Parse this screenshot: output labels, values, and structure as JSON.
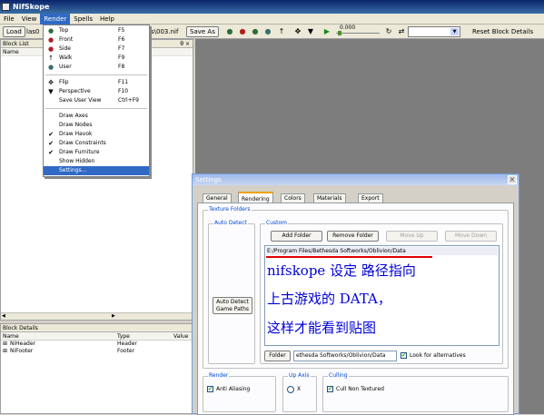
{
  "window": {
    "title": "NifSkope"
  },
  "menubar": {
    "items": [
      "File",
      "View",
      "Render",
      "Spells",
      "Help"
    ]
  },
  "toolbar": {
    "load": "Load",
    "path_left": "las0",
    "path_right": "s\\003.nif",
    "save_as": "Save As",
    "slider_value": "0.000",
    "reset_block_details": "Reset Block Details"
  },
  "render_menu": {
    "items": [
      {
        "icon": "view-top-icon",
        "label": "Top",
        "shortcut": "F5",
        "check": false
      },
      {
        "icon": "view-front-icon",
        "label": "Front",
        "shortcut": "F6",
        "check": false
      },
      {
        "icon": "view-side-icon",
        "label": "Side",
        "shortcut": "F7",
        "check": false
      },
      {
        "icon": "walk-icon",
        "label": "Walk",
        "shortcut": "F9",
        "check": false
      },
      {
        "icon": "user-view-icon",
        "label": "User",
        "shortcut": "F8",
        "check": false
      },
      {
        "icon": "flip-icon",
        "label": "Flip",
        "shortcut": "F11",
        "check": false
      },
      {
        "icon": "perspective-icon",
        "label": "Perspective",
        "shortcut": "F10",
        "check": false
      },
      {
        "icon": "",
        "label": "Save User View",
        "shortcut": "Ctrl+F9",
        "check": false
      },
      {
        "icon": "",
        "label": "Draw Axes",
        "shortcut": "",
        "check": false
      },
      {
        "icon": "",
        "label": "Draw Nodes",
        "shortcut": "",
        "check": false
      },
      {
        "icon": "",
        "label": "Draw Havok",
        "shortcut": "",
        "check": true
      },
      {
        "icon": "",
        "label": "Draw Constraints",
        "shortcut": "",
        "check": true
      },
      {
        "icon": "",
        "label": "Draw Furniture",
        "shortcut": "",
        "check": true
      },
      {
        "icon": "",
        "label": "Show Hidden",
        "shortcut": "",
        "check": false
      },
      {
        "icon": "",
        "label": "Settings...",
        "shortcut": "",
        "check": false
      }
    ]
  },
  "block_list": {
    "title": "Block List",
    "col_name": "Name",
    "pin": "θ ×"
  },
  "block_details": {
    "title": "Block Details",
    "columns": [
      "Name",
      "Type",
      "Value"
    ],
    "rows": [
      {
        "name": "NiHeader",
        "type": "Header"
      },
      {
        "name": "NiFooter",
        "type": "Footer"
      }
    ]
  },
  "settings": {
    "title": "Settings",
    "close": "×",
    "tabs": [
      "General",
      "Rendering",
      "Colors",
      "Materials",
      "Export"
    ],
    "texture_folders": "Texture Folders",
    "auto_detect_group": "Auto Detect",
    "auto_detect_button": "Auto Detect\nGame Paths",
    "custom_group": "Custom",
    "add_folder": "Add Folder",
    "remove_folder": "Remove Folder",
    "move_up": "Move Up",
    "move_down": "Move Down",
    "folder_path": "E:/Program Files/Bethesda Softworks/Oblivion/Data",
    "folder_button": "Folder",
    "folder_field": "ethesda Softworks/Oblivion/Data",
    "look_for_alternatives": "Look for alternatives",
    "render_group": "Render",
    "anti_aliasing": "Anti Aliasing",
    "up_axis_group": "Up Axis",
    "up_axis_x": "X",
    "culling_group": "Culling",
    "cull_non_textured": "Cull Non Textured"
  },
  "annotation": {
    "line1": "nifskope 设定 路径指向",
    "line2": "上古游戏的 DATA，",
    "line3": "这样才能看到贴图",
    "underline_color": "#e00000",
    "text_color": "#0000d8"
  }
}
